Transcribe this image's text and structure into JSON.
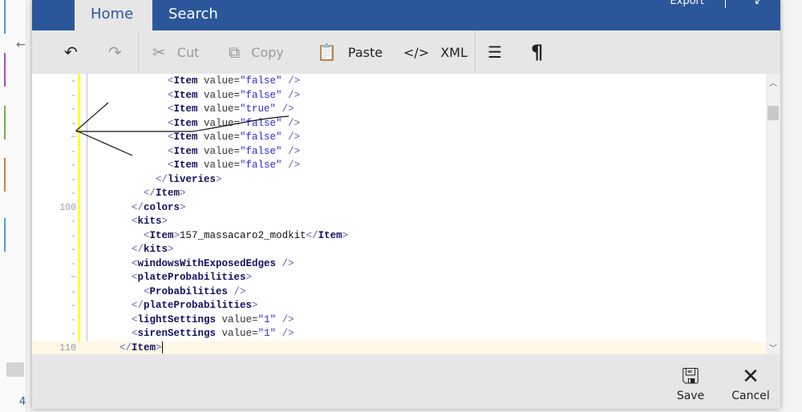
{
  "background": {
    "corner_number": "4"
  },
  "header": {
    "tabs": [
      {
        "label": "Home",
        "active": true
      },
      {
        "label": "Search",
        "active": false
      }
    ],
    "export_label": "Export",
    "expand_icon": "expand-icon"
  },
  "toolbar": {
    "undo_icon": "undo-icon",
    "redo_icon": "redo-icon",
    "cut_label": "Cut",
    "copy_label": "Copy",
    "paste_label": "Paste",
    "xml_label": "XML",
    "format_icon": "word-wrap-icon",
    "pilcrow_icon": "pilcrow-icon"
  },
  "editor": {
    "lines": [
      {
        "ln": "-",
        "indent": 12,
        "parts": [
          [
            "p",
            "<"
          ],
          [
            "t",
            "Item"
          ],
          [
            "a",
            " value="
          ],
          [
            "v",
            "\"false\""
          ],
          [
            "p",
            " />"
          ]
        ]
      },
      {
        "ln": "-",
        "indent": 12,
        "parts": [
          [
            "p",
            "<"
          ],
          [
            "t",
            "Item"
          ],
          [
            "a",
            " value="
          ],
          [
            "v",
            "\"false\""
          ],
          [
            "p",
            " />"
          ]
        ]
      },
      {
        "ln": "-",
        "indent": 12,
        "parts": [
          [
            "p",
            "<"
          ],
          [
            "t",
            "Item"
          ],
          [
            "a",
            " value="
          ],
          [
            "v",
            "\"true\""
          ],
          [
            "p",
            " />"
          ]
        ]
      },
      {
        "ln": "-",
        "indent": 12,
        "parts": [
          [
            "p",
            "<"
          ],
          [
            "t",
            "Item"
          ],
          [
            "a",
            " value="
          ],
          [
            "v",
            "\"false\""
          ],
          [
            "p",
            " />"
          ]
        ]
      },
      {
        "ln": "−",
        "indent": 12,
        "parts": [
          [
            "p",
            "<"
          ],
          [
            "t",
            "Item"
          ],
          [
            "a",
            " value="
          ],
          [
            "v",
            "\"false\""
          ],
          [
            "p",
            " />"
          ]
        ]
      },
      {
        "ln": "-",
        "indent": 12,
        "parts": [
          [
            "p",
            "<"
          ],
          [
            "t",
            "Item"
          ],
          [
            "a",
            " value="
          ],
          [
            "v",
            "\"false\""
          ],
          [
            "p",
            " />"
          ]
        ]
      },
      {
        "ln": "-",
        "indent": 12,
        "parts": [
          [
            "p",
            "<"
          ],
          [
            "t",
            "Item"
          ],
          [
            "a",
            " value="
          ],
          [
            "v",
            "\"false\""
          ],
          [
            "p",
            " />"
          ]
        ]
      },
      {
        "ln": "-",
        "indent": 10,
        "parts": [
          [
            "p",
            "</"
          ],
          [
            "t",
            "liveries"
          ],
          [
            "p",
            ">"
          ]
        ]
      },
      {
        "ln": "-",
        "indent": 8,
        "parts": [
          [
            "p",
            "</"
          ],
          [
            "t",
            "Item"
          ],
          [
            "p",
            ">"
          ]
        ]
      },
      {
        "ln": "100",
        "indent": 6,
        "parts": [
          [
            "p",
            "</"
          ],
          [
            "t",
            "colors"
          ],
          [
            "p",
            ">"
          ]
        ]
      },
      {
        "ln": "-",
        "indent": 6,
        "parts": [
          [
            "p",
            "<"
          ],
          [
            "t",
            "kits"
          ],
          [
            "p",
            ">"
          ]
        ]
      },
      {
        "ln": "-",
        "indent": 8,
        "parts": [
          [
            "p",
            "<"
          ],
          [
            "t",
            "Item"
          ],
          [
            "p",
            ">"
          ],
          [
            "x",
            "157_massacaro2_modkit"
          ],
          [
            "p",
            "</"
          ],
          [
            "t",
            "Item"
          ],
          [
            "p",
            ">"
          ]
        ]
      },
      {
        "ln": "-",
        "indent": 6,
        "parts": [
          [
            "p",
            "</"
          ],
          [
            "t",
            "kits"
          ],
          [
            "p",
            ">"
          ]
        ]
      },
      {
        "ln": "-",
        "indent": 6,
        "parts": [
          [
            "p",
            "<"
          ],
          [
            "t",
            "windowsWithExposedEdges"
          ],
          [
            "p",
            " />"
          ]
        ]
      },
      {
        "ln": "−",
        "indent": 6,
        "parts": [
          [
            "p",
            "<"
          ],
          [
            "t",
            "plateProbabilities"
          ],
          [
            "p",
            ">"
          ]
        ]
      },
      {
        "ln": "-",
        "indent": 8,
        "parts": [
          [
            "p",
            "<"
          ],
          [
            "t",
            "Probabilities"
          ],
          [
            "p",
            " />"
          ]
        ]
      },
      {
        "ln": "-",
        "indent": 6,
        "parts": [
          [
            "p",
            "</"
          ],
          [
            "t",
            "plateProbabilities"
          ],
          [
            "p",
            ">"
          ]
        ]
      },
      {
        "ln": "-",
        "indent": 6,
        "parts": [
          [
            "p",
            "<"
          ],
          [
            "t",
            "lightSettings"
          ],
          [
            "a",
            " value="
          ],
          [
            "v",
            "\"1\""
          ],
          [
            "p",
            " />"
          ]
        ]
      },
      {
        "ln": "-",
        "indent": 6,
        "parts": [
          [
            "p",
            "<"
          ],
          [
            "t",
            "sirenSettings"
          ],
          [
            "a",
            " value="
          ],
          [
            "v",
            "\"1\""
          ],
          [
            "p",
            " />"
          ]
        ]
      },
      {
        "ln": "110",
        "indent": 4,
        "current": true,
        "parts": [
          [
            "p",
            "</"
          ],
          [
            "t",
            "Item"
          ],
          [
            "p",
            ">"
          ]
        ]
      }
    ]
  },
  "footer": {
    "save_label": "Save",
    "cancel_label": "Cancel"
  },
  "colors": {
    "accent": "#2b579a",
    "gutter_marker": "#ffff33",
    "current_line": "#fff8e6"
  }
}
